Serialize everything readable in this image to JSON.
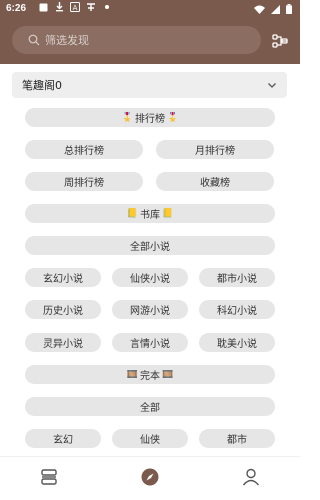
{
  "status_bar": {
    "time": "6:26",
    "icons_left": [
      "square-icon",
      "download-icon",
      "a-icon",
      "app-icon",
      "dot-icon"
    ],
    "icons_right": [
      "wifi-icon",
      "signal-icon",
      "battery-icon"
    ]
  },
  "header": {
    "search_placeholder": "筛选发现"
  },
  "source_select": {
    "selected": "笔趣阁0"
  },
  "sections": [
    {
      "title": "排行榜",
      "rows": [
        [
          "总排行榜",
          "月排行榜"
        ],
        [
          "周排行榜",
          "收藏榜"
        ]
      ]
    },
    {
      "title": "书库",
      "all_label": "全部小说",
      "rows": [
        [
          "玄幻小说",
          "仙侠小说",
          "都市小说"
        ],
        [
          "历史小说",
          "网游小说",
          "科幻小说"
        ],
        [
          "灵异小说",
          "言情小说",
          "耽美小说"
        ]
      ]
    },
    {
      "title": "完本",
      "all_label": "全部",
      "rows": [
        [
          "玄幻",
          "仙侠",
          "都市"
        ]
      ]
    }
  ],
  "bottom_nav": [
    {
      "name": "bookshelf",
      "icon": "bookshelf-icon"
    },
    {
      "name": "discover",
      "icon": "compass-icon"
    },
    {
      "name": "profile",
      "icon": "user-icon"
    }
  ],
  "colors": {
    "header_bg": "#7b5a4e",
    "pill_bg": "#e6e6e6",
    "dropdown_bg": "#eeeeee"
  }
}
